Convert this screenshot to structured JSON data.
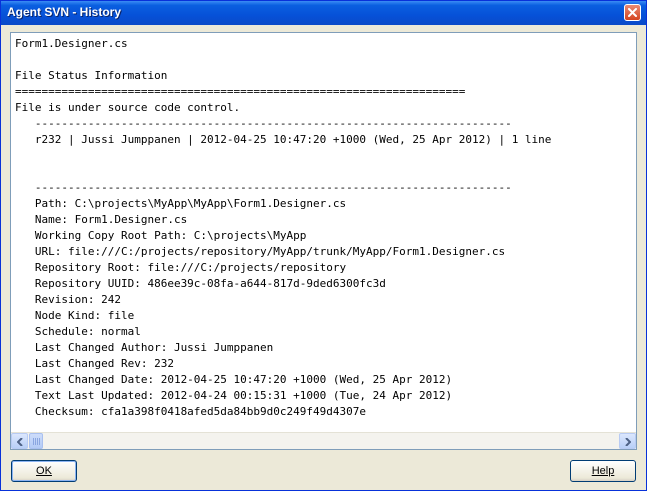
{
  "window": {
    "title": "Agent SVN - History"
  },
  "content": {
    "text": "Form1.Designer.cs\n\nFile Status Information\n====================================================================\nFile is under source code control.\n   ------------------------------------------------------------------------\n   r232 | Jussi Jumppanen | 2012-04-25 10:47:20 +1000 (Wed, 25 Apr 2012) | 1 line\n\n\n   ------------------------------------------------------------------------\n   Path: C:\\projects\\MyApp\\MyApp\\Form1.Designer.cs\n   Name: Form1.Designer.cs\n   Working Copy Root Path: C:\\projects\\MyApp\n   URL: file:///C:/projects/repository/MyApp/trunk/MyApp/Form1.Designer.cs\n   Repository Root: file:///C:/projects/repository\n   Repository UUID: 486ee39c-08fa-a644-817d-9ded6300fc3d\n   Revision: 242\n   Node Kind: file\n   Schedule: normal\n   Last Changed Author: Jussi Jumppanen\n   Last Changed Rev: 232\n   Last Changed Date: 2012-04-25 10:47:20 +1000 (Wed, 25 Apr 2012)\n   Text Last Updated: 2012-04-24 00:15:31 +1000 (Tue, 24 Apr 2012)\n   Checksum: cfa1a398f0418afed5da84bb9d0c249f49d4307e"
  },
  "buttons": {
    "ok_label": "OK",
    "help_label": "Help"
  },
  "colors": {
    "titlebar": "#0651d8",
    "close_button": "#d5441f",
    "window_bg": "#ece9d8",
    "scrollbar_button": "#c1d3fb"
  },
  "icons": {
    "close": "close-icon",
    "scroll_left": "arrow-left-icon",
    "scroll_right": "arrow-right-icon"
  }
}
